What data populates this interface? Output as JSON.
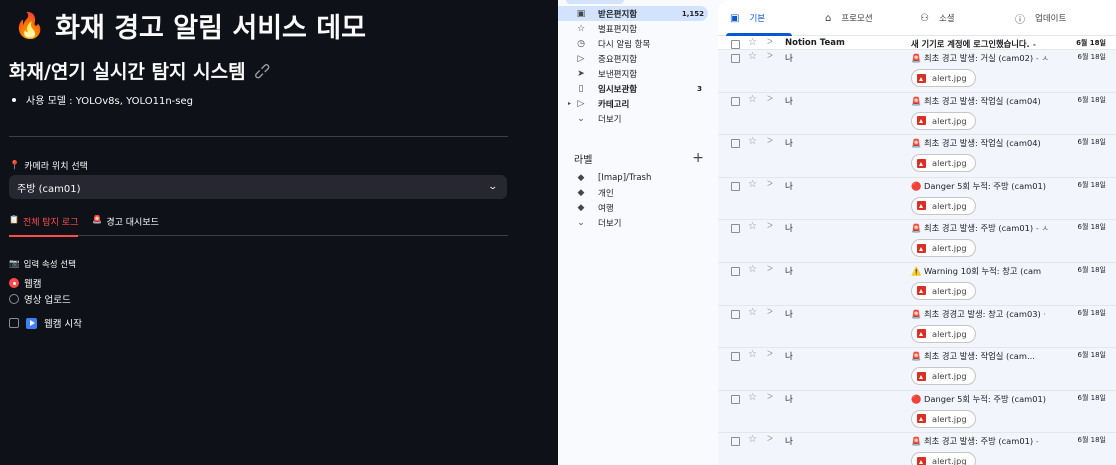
{
  "streamlit": {
    "title": "화재 경고 알림 서비스 데모",
    "title_icon": "🔥",
    "subtitle": "화재/연기 실시간 탐지 시스템",
    "model_info": "사용 모델 : YOLOv8s, YOLO11n-seg",
    "camera_label": "카메라 위치 선택",
    "camera_selected": "주방 (cam01)",
    "tabs": [
      {
        "icon": "📋",
        "label": "전체 탐지 로그"
      },
      {
        "icon": "🚨",
        "label": "경고 대시보드"
      }
    ],
    "input_label": "입력 속성 선택",
    "input_icon": "📷",
    "radio_options": [
      "웹캠",
      "영상 업로드"
    ],
    "radio_selected": "웹캠",
    "webcam_checkbox": "웹캠 시작",
    "accent_color": "#ff4b4b"
  },
  "gmail": {
    "nav": [
      {
        "icon": "inbox-icon",
        "glyph": "▣",
        "label": "받은편지함",
        "count": "1,152",
        "selected": true
      },
      {
        "icon": "star-icon",
        "glyph": "☆",
        "label": "별표편지함"
      },
      {
        "icon": "clock-icon",
        "glyph": "◷",
        "label": "다시 알림 항목"
      },
      {
        "icon": "important-icon",
        "glyph": "▷",
        "label": "중요편지함"
      },
      {
        "icon": "send-icon",
        "glyph": "➤",
        "label": "보낸편지함"
      },
      {
        "icon": "draft-icon",
        "glyph": "▯",
        "label": "임시보관함",
        "count": "3",
        "bold": true
      },
      {
        "icon": "category-icon",
        "glyph": "▷",
        "label": "카테고리",
        "bold": true,
        "caret": true
      },
      {
        "icon": "chevron-down-icon",
        "glyph": "⌄",
        "label": "더보기"
      }
    ],
    "labels_heading": "라벨",
    "labels": [
      {
        "icon": "label-icon",
        "glyph": "◆",
        "label": "[Imap]/Trash"
      },
      {
        "icon": "label-icon",
        "glyph": "◆",
        "label": "개인"
      },
      {
        "icon": "label-icon",
        "glyph": "◆",
        "label": "여행"
      },
      {
        "icon": "chevron-down-icon",
        "glyph": "⌄",
        "label": "더보기"
      }
    ],
    "mail_tabs": [
      {
        "icon": "inbox-icon",
        "glyph": "▣",
        "label": "기본",
        "active": true
      },
      {
        "icon": "tag-icon",
        "glyph": "⌂",
        "label": "프로모션"
      },
      {
        "icon": "people-icon",
        "glyph": "⚇",
        "label": "소셜"
      },
      {
        "icon": "info-icon",
        "glyph": "ⓘ",
        "label": "업데이트"
      }
    ],
    "emails": [
      {
        "sender": "Notion Team",
        "subject": "새 기기로 계정에 로그인했습니다.",
        "snippet": " - ",
        "date": "6월 18일",
        "unread": true
      },
      {
        "sender": "나",
        "subject": "🚨 최초 경고 발생: 거실 (cam02)",
        "snippet": " - ㅅ",
        "date": "6월 18일",
        "attachment": "alert.jpg"
      },
      {
        "sender": "나",
        "subject": "🚨 최초 경고 발생: 작업실 (cam04)",
        "snippet": "",
        "date": "6월 18일",
        "attachment": "alert.jpg"
      },
      {
        "sender": "나",
        "subject": "🚨 최초 경고 발생: 작업실 (cam04)",
        "snippet": "",
        "date": "6월 18일",
        "attachment": "alert.jpg"
      },
      {
        "sender": "나",
        "subject": "🔴 Danger 5회 누적: 주방 (cam01)",
        "snippet": "",
        "date": "6월 18일",
        "attachment": "alert.jpg"
      },
      {
        "sender": "나",
        "subject": "🚨 최초 경고 발생: 주방 (cam01)",
        "snippet": " - ㅅ",
        "date": "6월 18일",
        "attachment": "alert.jpg"
      },
      {
        "sender": "나",
        "subject": "⚠️ Warning 10회 누적: 창고 (cam",
        "snippet": "",
        "date": "6월 18일",
        "attachment": "alert.jpg"
      },
      {
        "sender": "나",
        "subject": "🚨 최초 경경고 발생: 창고 (cam03)",
        "snippet": " ·",
        "date": "6월 18일",
        "attachment": "alert.jpg"
      },
      {
        "sender": "나",
        "subject": "🚨 최초 경고 발생: 작업실 (cam...",
        "snippet": "",
        "date": "6월 18일",
        "attachment": "alert.jpg"
      },
      {
        "sender": "나",
        "subject": "🔴 Danger 5회 누적: 주방 (cam01)",
        "snippet": "",
        "date": "6월 18일",
        "attachment": "alert.jpg"
      },
      {
        "sender": "나",
        "subject": "🚨 최초 경고 발생: 주방 (cam01)",
        "snippet": " -",
        "date": "6월 18일",
        "attachment": "alert.jpg"
      }
    ]
  }
}
